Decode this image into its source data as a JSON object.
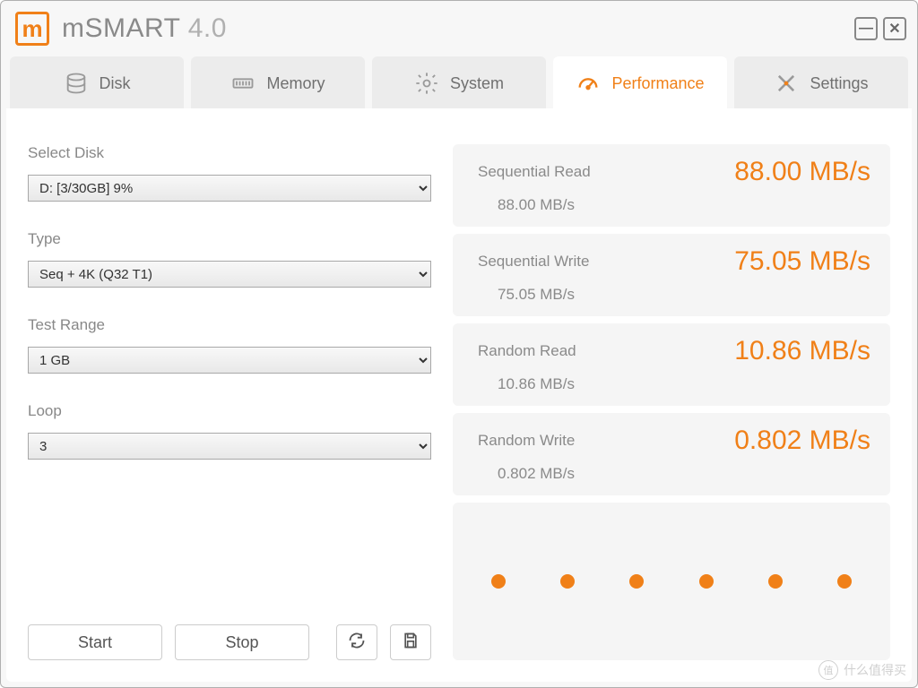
{
  "app": {
    "name": "mSMART",
    "version": "4.0"
  },
  "window_buttons": {
    "minimize": "—",
    "close": "✕"
  },
  "tabs": [
    {
      "id": "disk",
      "label": "Disk"
    },
    {
      "id": "memory",
      "label": "Memory"
    },
    {
      "id": "system",
      "label": "System"
    },
    {
      "id": "performance",
      "label": "Performance",
      "active": true
    },
    {
      "id": "settings",
      "label": "Settings"
    }
  ],
  "form": {
    "select_disk": {
      "label": "Select Disk",
      "value": "D: [3/30GB] 9%"
    },
    "type": {
      "label": "Type",
      "value": "Seq + 4K (Q32 T1)"
    },
    "test_range": {
      "label": "Test Range",
      "value": "1 GB"
    },
    "loop": {
      "label": "Loop",
      "value": "3"
    }
  },
  "buttons": {
    "start": "Start",
    "stop": "Stop"
  },
  "results": [
    {
      "title": "Sequential Read",
      "value": "88.00 MB/s",
      "sub": "88.00 MB/s"
    },
    {
      "title": "Sequential Write",
      "value": "75.05 MB/s",
      "sub": "75.05 MB/s"
    },
    {
      "title": "Random Read",
      "value": "10.86 MB/s",
      "sub": "10.86 MB/s"
    },
    {
      "title": "Random Write",
      "value": "0.802 MB/s",
      "sub": "0.802 MB/s"
    }
  ],
  "dot_count": 6,
  "watermark": "什么值得买",
  "colors": {
    "accent": "#f08018"
  }
}
